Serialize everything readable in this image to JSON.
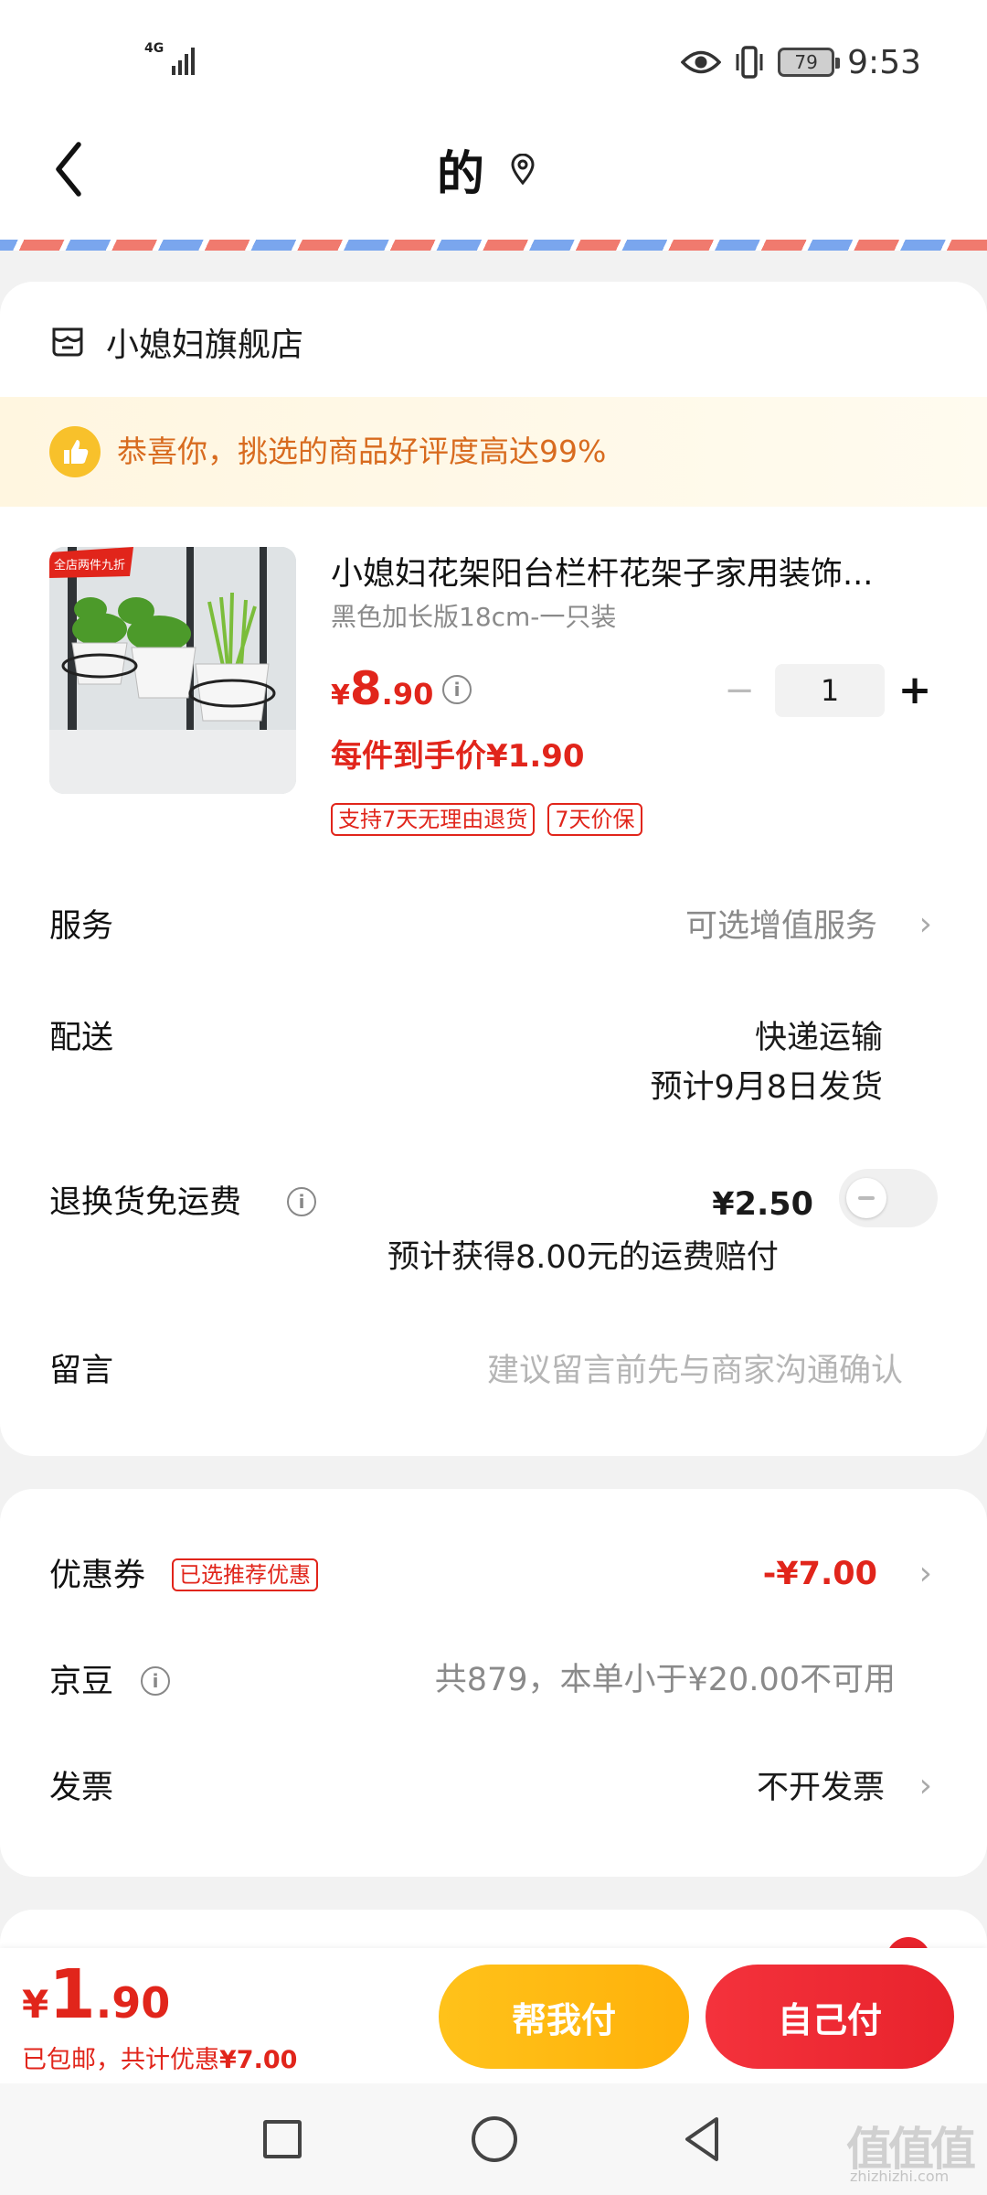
{
  "status_bar": {
    "network": "4G",
    "battery": "79",
    "time": "9:53"
  },
  "header": {
    "title": "的"
  },
  "shop": {
    "name": "小媳妇旗舰店"
  },
  "tip": {
    "text": "恭喜你，挑选的商品好评度高达99%"
  },
  "product": {
    "image_badge": "全店两件九折",
    "title": "小媳妇花架阳台栏杆花架子家用装饰...",
    "spec": "黑色加长版18cm-一只装",
    "price_yen": "¥",
    "price_int": "8",
    "price_dec": ".90",
    "quantity": "1",
    "unit_price": "每件到手价¥1.90",
    "tags": [
      "支持7天无理由退货",
      "7天价保"
    ]
  },
  "rows": {
    "service_label": "服务",
    "service_value": "可选增值服务",
    "delivery_label": "配送",
    "delivery_method": "快递运输",
    "delivery_date": "预计9月8日发货",
    "return_label": "退换货免运费",
    "return_price": "¥2.50",
    "return_note": "预计获得8.00元的运费赔付",
    "message_label": "留言",
    "message_placeholder": "建议留言前先与商家沟通确认"
  },
  "discount": {
    "coupon_label": "优惠券",
    "coupon_tag": "已选推荐优惠",
    "coupon_value": "-¥7.00",
    "beans_label": "京豆",
    "beans_value": "共879，本单小于¥20.00不可用",
    "invoice_label": "发票",
    "invoice_value": "不开发票"
  },
  "footer": {
    "total_yen": "¥",
    "total_int": "1",
    "total_dec": ".90",
    "shipping_text": "已包邮，共计优惠",
    "discount_amount": "¥7.00",
    "help_pay_label": "帮我付",
    "self_pay_label": "自己付"
  },
  "watermark": {
    "logo": "值值值",
    "url": "zhizhizhi.com"
  },
  "colors": {
    "accent": "#e1251b",
    "help_button": "#ffb10a",
    "tip_text": "#d86b1f"
  }
}
